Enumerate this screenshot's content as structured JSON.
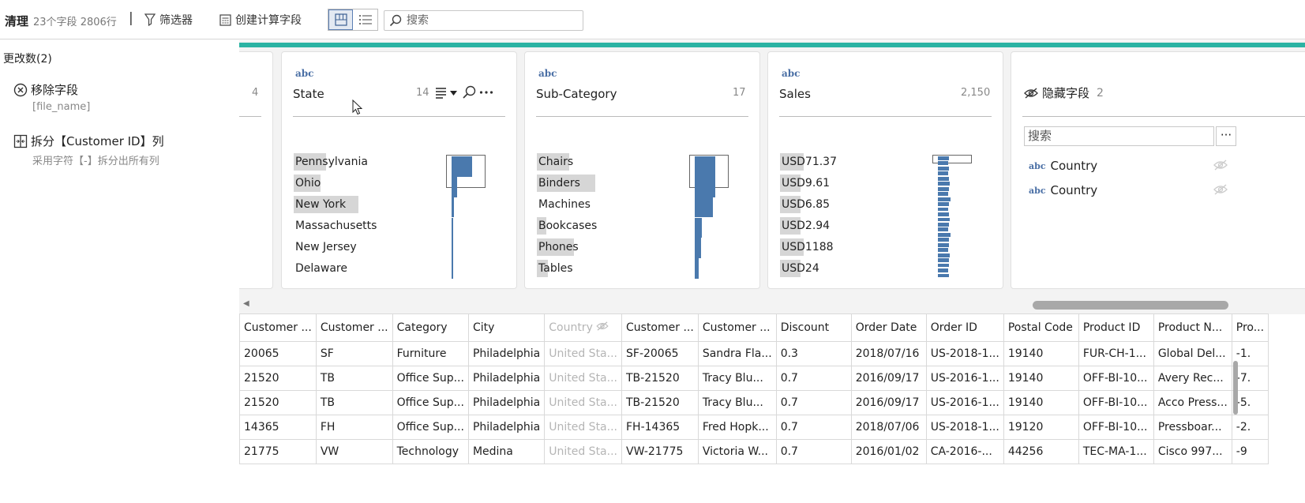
{
  "toolbar": {
    "title": "清理",
    "field_count": "23个字段",
    "row_count": "2806行",
    "separator": "|",
    "filter_label": "筛选器",
    "calc_label": "创建计算字段",
    "search_placeholder": "搜索"
  },
  "changes": {
    "title": "更改数(2)",
    "items": [
      {
        "label": "移除字段",
        "detail": "[file_name]",
        "icon": "remove-circle-icon"
      },
      {
        "label": "拆分【Customer ID】列",
        "detail": "采用字符【-】拆分出所有列",
        "icon": "split-column-icon"
      }
    ]
  },
  "profile": {
    "partial_card_count": "4",
    "cards": [
      {
        "type": "abc",
        "name": "State",
        "count": "14",
        "values": [
          "Pennsylvania",
          "Ohio",
          "New York",
          "Massachusetts",
          "New Jersey",
          "Delaware"
        ],
        "value_highlight": [
          0.5,
          0.42,
          1.0,
          0.0,
          0.0,
          0.0
        ],
        "histogram": [
          1.0,
          0.25,
          0.1,
          0.08,
          0.06,
          0.04
        ]
      },
      {
        "type": "abc",
        "name": "Sub-Category",
        "count": "17",
        "values": [
          "Chairs",
          "Binders",
          "Machines",
          "Bookcases",
          "Phones",
          "Tables"
        ],
        "value_highlight": [
          0.52,
          0.95,
          0.0,
          0.15,
          0.6,
          0.18
        ],
        "histogram": [
          1.0,
          1.0,
          0.9,
          0.35,
          0.3,
          0.2
        ]
      },
      {
        "type": "abc",
        "name": "Sales",
        "count": "2,150",
        "values": [
          "USD71.37",
          "USD9.61",
          "USD6.85",
          "USD2.94",
          "USD1188",
          "USD24"
        ],
        "value_highlight": [
          0.62,
          0.55,
          0.55,
          0.55,
          0.62,
          0.55
        ],
        "histogram": [
          0.9,
          0.8,
          0.85,
          0.8,
          0.9,
          0.95,
          0.85,
          0.8,
          1.0,
          0.9,
          0.8,
          0.85,
          0.95,
          0.9,
          0.8,
          1.0,
          0.85,
          0.9,
          0.8,
          0.95,
          0.9,
          0.85,
          0.8,
          0.9
        ]
      }
    ],
    "hidden": {
      "title": "隐藏字段",
      "count": "2",
      "search_placeholder": "搜索",
      "more": "···",
      "fields": [
        "Country",
        "Country"
      ]
    }
  },
  "grid": {
    "columns": [
      "Customer ...",
      "Customer ...",
      "Category",
      "City",
      "Country",
      "Customer ...",
      "Customer ...",
      "Discount",
      "Order Date",
      "Order ID",
      "Postal Code",
      "Product ID",
      "Product N...",
      "Pro..."
    ],
    "muted_column": 4,
    "rows": [
      [
        "20065",
        "SF",
        "Furniture",
        "Philadelphia",
        "United Sta...",
        "SF-20065",
        "Sandra Fla...",
        "0.3",
        "2018/07/16",
        "US-2018-1...",
        "19140",
        "FUR-CH-1...",
        "Global Del...",
        "-1."
      ],
      [
        "21520",
        "TB",
        "Office Sup...",
        "Philadelphia",
        "United Sta...",
        "TB-21520",
        "Tracy Blu...",
        "0.7",
        "2016/09/17",
        "US-2016-1...",
        "19140",
        "OFF-BI-10...",
        "Avery Rec...",
        "-7."
      ],
      [
        "21520",
        "TB",
        "Office Sup...",
        "Philadelphia",
        "United Sta...",
        "TB-21520",
        "Tracy Blu...",
        "0.7",
        "2016/09/17",
        "US-2016-1...",
        "19140",
        "OFF-BI-10...",
        "Acco Press...",
        "-5."
      ],
      [
        "14365",
        "FH",
        "Office Sup...",
        "Philadelphia",
        "United Sta...",
        "FH-14365",
        "Fred Hopk...",
        "0.7",
        "2018/07/06",
        "US-2018-1...",
        "19120",
        "OFF-BI-10...",
        "Pressboar...",
        "-2."
      ],
      [
        "21775",
        "VW",
        "Technology",
        "Medina",
        "United Sta...",
        "VW-21775",
        "Victoria W...",
        "0.7",
        "2016/01/02",
        "CA-2016-...",
        "44256",
        "TEC-MA-1...",
        "Cisco 997...",
        "-9"
      ]
    ]
  },
  "colors": {
    "accent": "#2bb3a3",
    "bar": "#4a79ad",
    "type_label": "#4a6fa5"
  }
}
